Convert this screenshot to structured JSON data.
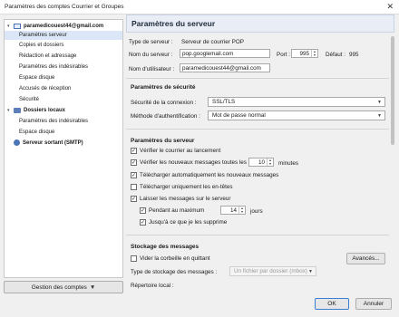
{
  "window": {
    "title": "Paramètres des comptes Courrier et Groupes",
    "close_glyph": "✕"
  },
  "sidebar": {
    "items": [
      {
        "label": "paramedicouest44@gmail.com",
        "icon": "envelope-icon"
      },
      {
        "label": "Paramètres serveur"
      },
      {
        "label": "Copies et dossiers"
      },
      {
        "label": "Rédaction et adressage"
      },
      {
        "label": "Paramètres des indésirables"
      },
      {
        "label": "Espace disque"
      },
      {
        "label": "Accusés de réception"
      },
      {
        "label": "Sécurité"
      },
      {
        "label": "Dossiers locaux",
        "icon": "folder-icon"
      },
      {
        "label": "Paramètres des indésirables"
      },
      {
        "label": "Espace disque"
      },
      {
        "label": "Serveur sortant (SMTP)",
        "icon": "smtp-icon"
      }
    ],
    "manage_button": "Gestion des comptes"
  },
  "main": {
    "title": "Paramètres du serveur",
    "server_type_label": "Type de serveur :",
    "server_type_value": "Serveur de courrier POP",
    "server_name_label": "Nom du serveur :",
    "server_name_value": "pop.googlemail.com",
    "port_label": "Port :",
    "port_value": "995",
    "default_label": "Défaut :",
    "default_value": "995",
    "username_label": "Nom d'utilisateur :",
    "username_value": "paramedicouest44@gmail.com",
    "security": {
      "title": "Paramètres de sécurité",
      "connection_label": "Sécurité de la connexion :",
      "connection_value": "SSL/TLS",
      "auth_label": "Méthode d'authentification :",
      "auth_value": "Mot de passe normal"
    },
    "server": {
      "title": "Paramètres du serveur",
      "check_startup": "Vérifier le courrier au lancement",
      "check_every": "Vérifier les nouveaux messages toutes les",
      "check_every_value": "10",
      "minutes": "minutes",
      "auto_download": "Télécharger automatiquement les nouveaux messages",
      "headers_only": "Télécharger uniquement les en-têtes",
      "leave_on_server": "Laisser les messages sur le serveur",
      "max_days": "Pendant au maximum",
      "max_days_value": "14",
      "days": "jours",
      "until_deleted": "Jusqu'à ce que je les supprime"
    },
    "storage": {
      "title": "Stockage des messages",
      "empty_trash": "Vider la corbeille en quittant",
      "advanced_button": "Avancés...",
      "storage_type_label": "Type de stockage des messages :",
      "storage_type_value": "Un fichier par dossier (mbox)",
      "local_dir_label": "Répertoire local :"
    }
  },
  "footer": {
    "ok": "OK",
    "cancel": "Annuler"
  }
}
